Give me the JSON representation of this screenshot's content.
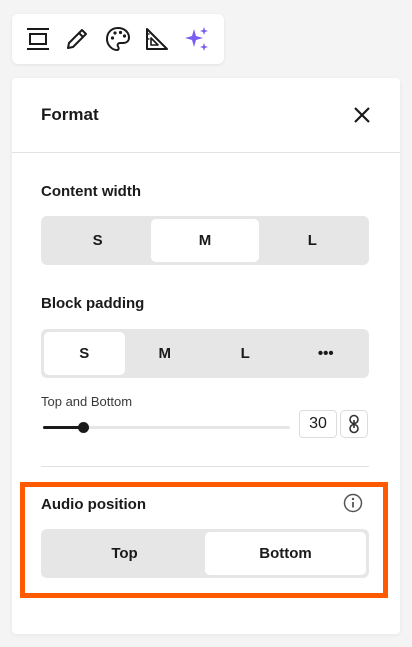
{
  "toolbar": {
    "tools": [
      {
        "icon": "align-center-icon"
      },
      {
        "icon": "pencil-icon"
      },
      {
        "icon": "palette-icon"
      },
      {
        "icon": "set-square-icon"
      },
      {
        "icon": "ai-sparkle-icon"
      }
    ],
    "sparkle_color": "#7b5cf0"
  },
  "panel": {
    "title": "Format",
    "content_width": {
      "label": "Content width",
      "options": [
        "S",
        "M",
        "L"
      ],
      "selected": "M"
    },
    "block_padding": {
      "label": "Block padding",
      "options": [
        "S",
        "M",
        "L",
        "•••"
      ],
      "selected": "S",
      "sub_label": "Top and Bottom",
      "value": "30",
      "slider_fraction": 0.16
    },
    "audio_position": {
      "label": "Audio position",
      "options": [
        "Top",
        "Bottom"
      ],
      "selected": "Bottom"
    }
  },
  "highlight_color": "#ff5a00"
}
